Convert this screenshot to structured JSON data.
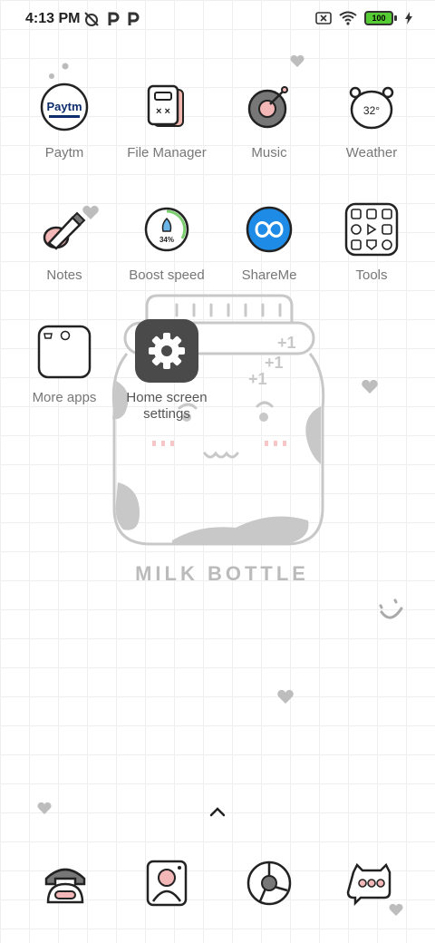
{
  "status_bar": {
    "time": "4:13 PM",
    "battery_level": "100"
  },
  "apps": [
    {
      "label": "Paytm",
      "icon": "paytm-icon",
      "logo_text": "Paytm"
    },
    {
      "label": "File Manager",
      "icon": "file-manager-icon"
    },
    {
      "label": "Music",
      "icon": "music-icon"
    },
    {
      "label": "Weather",
      "icon": "weather-icon",
      "temp": "32°"
    },
    {
      "label": "Notes",
      "icon": "notes-icon"
    },
    {
      "label": "Boost speed",
      "icon": "boost-speed-icon",
      "percent": "34%"
    },
    {
      "label": "ShareMe",
      "icon": "shareme-icon"
    },
    {
      "label": "Tools",
      "icon": "tools-folder-icon"
    },
    {
      "label": "More apps",
      "icon": "more-apps-folder-icon"
    },
    {
      "label": "Home screen settings",
      "icon": "gear-icon"
    }
  ],
  "wallpaper": {
    "title": "MILK BOTTLE"
  },
  "dock": [
    {
      "icon": "phone-icon"
    },
    {
      "icon": "contacts-icon"
    },
    {
      "icon": "browser-icon"
    },
    {
      "icon": "messages-icon"
    }
  ],
  "colors": {
    "paytm_blue": "#0d2d6c",
    "shareme_blue": "#1e8be6",
    "settings_gray": "#4a4a4a",
    "battery_green": "#55cc33"
  }
}
